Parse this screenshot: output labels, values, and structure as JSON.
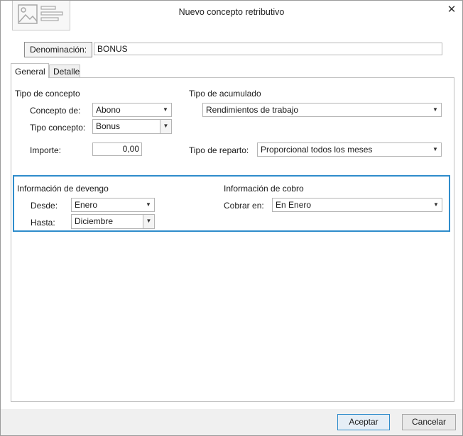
{
  "window": {
    "title": "Nuevo concepto retributivo"
  },
  "denominacion": {
    "label": "Denominación:",
    "value": "BONUS"
  },
  "tabs": [
    {
      "label": "General",
      "active": true
    },
    {
      "label": "Detalle",
      "active": false
    }
  ],
  "tipo_concepto": {
    "heading": "Tipo de concepto",
    "concepto_de": {
      "label": "Concepto de:",
      "value": "Abono"
    },
    "tipo": {
      "label": "Tipo concepto:",
      "value": "Bonus"
    },
    "importe": {
      "label": "Importe:",
      "value": "0,00"
    }
  },
  "tipo_acumulado": {
    "heading": "Tipo de acumulado",
    "value": "Rendimientos de trabajo",
    "reparto": {
      "label": "Tipo de reparto:",
      "value": "Proporcional todos los meses"
    }
  },
  "devengo": {
    "heading": "Información de devengo",
    "desde": {
      "label": "Desde:",
      "value": "Enero"
    },
    "hasta": {
      "label": "Hasta:",
      "value": "Diciembre"
    }
  },
  "cobro": {
    "heading": "Información de cobro",
    "cobrar_en": {
      "label": "Cobrar en:",
      "value": "En Enero"
    }
  },
  "footer": {
    "accept_label": "Aceptar",
    "cancel_label": "Cancelar"
  },
  "colors": {
    "accent": "#2e8ccb"
  }
}
